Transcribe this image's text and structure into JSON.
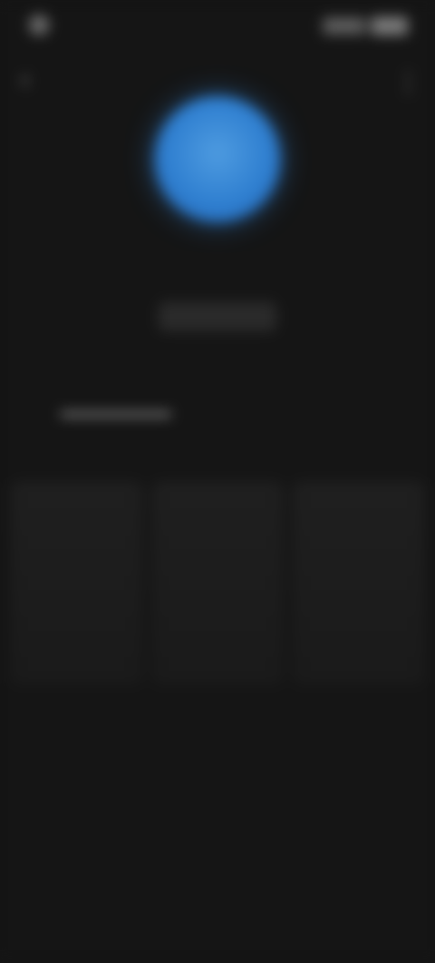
{
  "status_bar": {
    "time": "",
    "battery": ""
  },
  "top_bar": {
    "back_icon": "back-arrow-icon",
    "menu_icon": "menu-icon"
  },
  "profile": {
    "avatar_initial": "",
    "name": "",
    "handle": "",
    "edit_button": ""
  },
  "tabs": [
    {
      "label": ""
    },
    {
      "label": ""
    }
  ],
  "section": {
    "title": "",
    "action": ""
  },
  "grid": {
    "items": [
      {},
      {},
      {}
    ]
  },
  "empty_state": {
    "title": "",
    "subtitle": ""
  },
  "colors": {
    "background": "#151515",
    "accent": "#2f7fd0",
    "text_primary": "#e6e6e6",
    "text_secondary": "#7c7c7c"
  }
}
